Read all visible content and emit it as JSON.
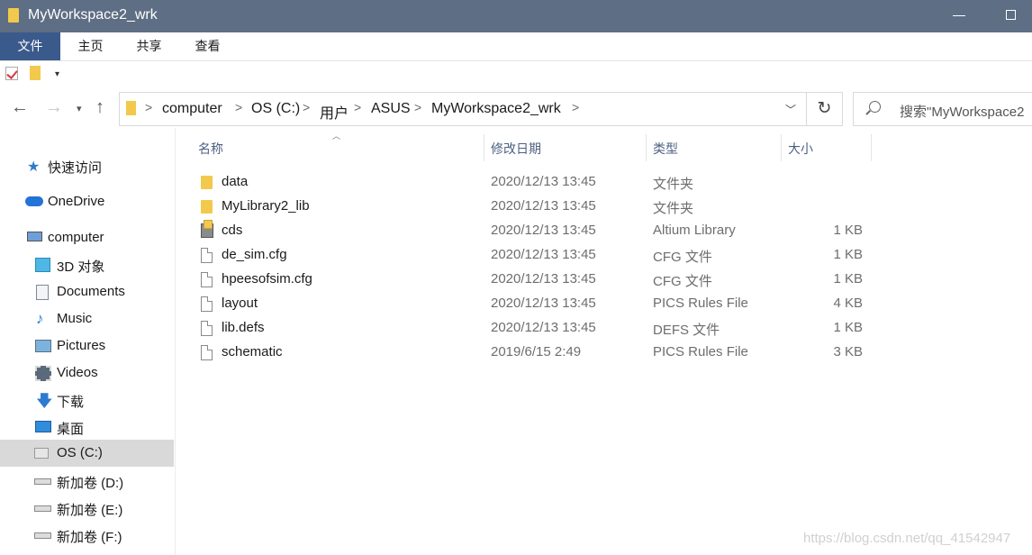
{
  "window": {
    "title": "MyWorkspace2_wrk"
  },
  "ribbon": {
    "tabs": [
      "文件",
      "主页",
      "共享",
      "查看"
    ]
  },
  "address": {
    "crumbs": [
      "computer",
      "OS (C:)",
      "用户",
      "ASUS",
      "MyWorkspace2_wrk"
    ]
  },
  "search": {
    "placeholder": "搜索\"MyWorkspace2"
  },
  "sidebar": {
    "items": [
      {
        "label": "快速访问",
        "icon": "star-icon"
      },
      {
        "label": "OneDrive",
        "icon": "cloud-icon"
      },
      {
        "label": "computer",
        "icon": "computer-icon"
      },
      {
        "label": "3D 对象",
        "icon": "cube-icon"
      },
      {
        "label": "Documents",
        "icon": "documents-icon"
      },
      {
        "label": "Music",
        "icon": "music-icon"
      },
      {
        "label": "Pictures",
        "icon": "pictures-icon"
      },
      {
        "label": "Videos",
        "icon": "videos-icon"
      },
      {
        "label": "下载",
        "icon": "download-icon"
      },
      {
        "label": "桌面",
        "icon": "desktop-icon"
      },
      {
        "label": "OS (C:)",
        "icon": "windows-drive-icon",
        "selected": true
      },
      {
        "label": "新加卷 (D:)",
        "icon": "drive-icon"
      },
      {
        "label": "新加卷 (E:)",
        "icon": "drive-icon"
      },
      {
        "label": "新加卷 (F:)",
        "icon": "drive-icon"
      }
    ]
  },
  "columns": {
    "name": "名称",
    "date": "修改日期",
    "type": "类型",
    "size": "大小"
  },
  "files": [
    {
      "name": "data",
      "date": "2020/12/13 13:45",
      "type": "文件夹",
      "size": "",
      "icon": "folder-icon"
    },
    {
      "name": "MyLibrary2_lib",
      "date": "2020/12/13 13:45",
      "type": "文件夹",
      "size": "",
      "icon": "folder-icon"
    },
    {
      "name": "cds",
      "date": "2020/12/13 13:45",
      "type": "Altium Library",
      "size": "1 KB",
      "icon": "library-icon"
    },
    {
      "name": "de_sim.cfg",
      "date": "2020/12/13 13:45",
      "type": "CFG 文件",
      "size": "1 KB",
      "icon": "file-icon"
    },
    {
      "name": "hpeesofsim.cfg",
      "date": "2020/12/13 13:45",
      "type": "CFG 文件",
      "size": "1 KB",
      "icon": "file-icon"
    },
    {
      "name": "layout",
      "date": "2020/12/13 13:45",
      "type": "PICS Rules File",
      "size": "4 KB",
      "icon": "file-icon"
    },
    {
      "name": "lib.defs",
      "date": "2020/12/13 13:45",
      "type": "DEFS 文件",
      "size": "1 KB",
      "icon": "file-icon"
    },
    {
      "name": "schematic",
      "date": "2019/6/15 2:49",
      "type": "PICS Rules File",
      "size": "3 KB",
      "icon": "file-icon"
    }
  ],
  "watermark": "https://blog.csdn.net/qq_41542947"
}
